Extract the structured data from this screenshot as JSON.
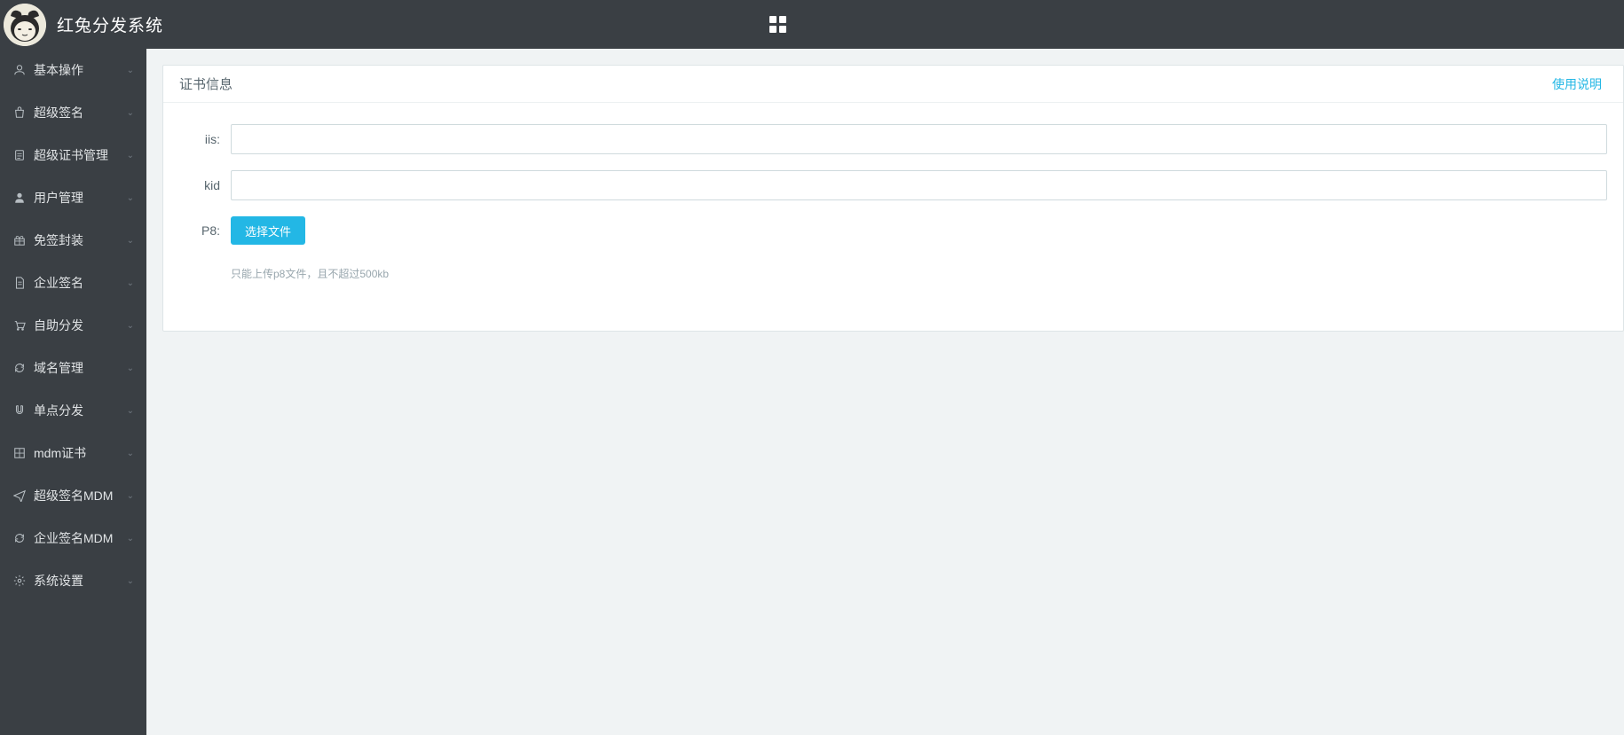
{
  "header": {
    "title": "红兔分发系统"
  },
  "sidebar": {
    "items": [
      {
        "label": "基本操作",
        "icon": "user"
      },
      {
        "label": "超级签名",
        "icon": "bag"
      },
      {
        "label": "超级证书管理",
        "icon": "clipboard"
      },
      {
        "label": "用户管理",
        "icon": "person"
      },
      {
        "label": "免签封装",
        "icon": "gift"
      },
      {
        "label": "企业签名",
        "icon": "doc"
      },
      {
        "label": "自助分发",
        "icon": "cart"
      },
      {
        "label": "域名管理",
        "icon": "refresh"
      },
      {
        "label": "单点分发",
        "icon": "magnet"
      },
      {
        "label": "mdm证书",
        "icon": "grid"
      },
      {
        "label": "超级签名MDM",
        "icon": "plane"
      },
      {
        "label": "企业签名MDM",
        "icon": "refresh"
      },
      {
        "label": "系统设置",
        "icon": "gear"
      }
    ]
  },
  "card": {
    "title": "证书信息",
    "link_label": "使用说明"
  },
  "form": {
    "iis_label": "iis:",
    "iis_value": "",
    "kid_label": "kid",
    "kid_value": "",
    "p8_label": "P8:",
    "upload_btn": "选择文件",
    "upload_hint": "只能上传p8文件，且不超过500kb"
  }
}
